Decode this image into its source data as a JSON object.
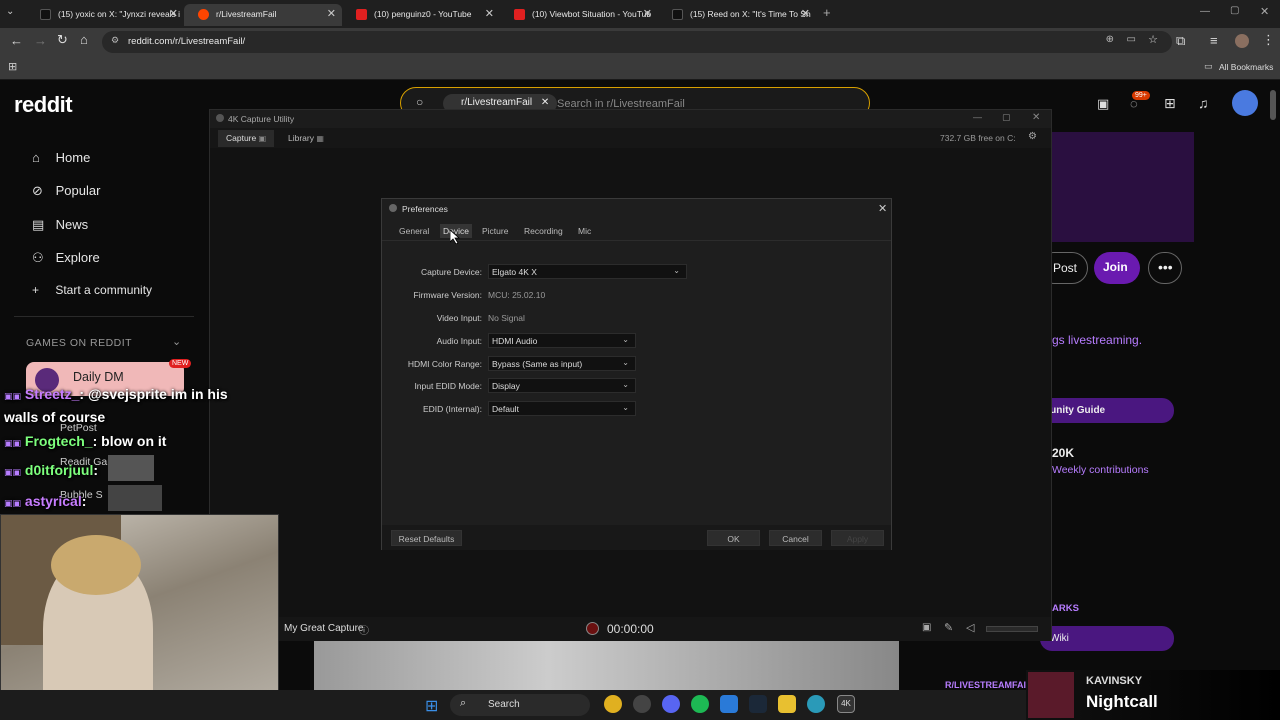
{
  "browser": {
    "tabs": [
      {
        "label": "(15) yoxic on X: \"Jynxzi reveals i",
        "fav": "#111"
      },
      {
        "label": "r/LivestreamFail",
        "fav": "#ff4500"
      },
      {
        "label": "(10) penguinz0 - YouTube",
        "fav": "#e02020"
      },
      {
        "label": "(10) Viewbot Situation - YouTub",
        "fav": "#e02020"
      },
      {
        "label": "(15) Reed on X: \"It's Time To Sh",
        "fav": "#111"
      }
    ],
    "url": "reddit.com/r/LivestreamFail/",
    "all_bookmarks": "All Bookmarks"
  },
  "reddit": {
    "logo": "reddit",
    "search_chip": "r/LivestreamFail",
    "search_placeholder": "Search in r/LivestreamFail",
    "notif_count": "99+",
    "nav": [
      {
        "label": "Home",
        "icon": "home-icon",
        "glyph": "⌂"
      },
      {
        "label": "Popular",
        "icon": "popular-icon",
        "glyph": "⊘"
      },
      {
        "label": "News",
        "icon": "news-icon",
        "glyph": "▤"
      },
      {
        "label": "Explore",
        "icon": "explore-icon",
        "glyph": "⚇"
      },
      {
        "label": "Start a community",
        "icon": "plus-icon",
        "glyph": "+"
      }
    ],
    "games_header": "GAMES ON REDDIT",
    "games": [
      {
        "name": "Daily DM",
        "badge": "NEW"
      },
      {
        "name": "PetPost"
      },
      {
        "name": "Readit Gam"
      },
      {
        "name": "Bubble S"
      }
    ],
    "right": {
      "post": "Post",
      "join": "Join",
      "desc": "gs livestreaming.",
      "guide": "nunity Guide",
      "count": "20K",
      "weekly": "Weekly contributions",
      "marks": "ARKS",
      "wiki": "Wiki",
      "sub": "R/LIVESTREAMFAIL"
    }
  },
  "capture": {
    "title": "4K Capture Utility",
    "tabs": [
      "Capture",
      "Library"
    ],
    "free_space": "732.7 GB free on C:",
    "capture_name": "My Great Capture",
    "timer": "00:00:00"
  },
  "prefs": {
    "title": "Preferences",
    "tabs": [
      "General",
      "Device",
      "Picture",
      "Recording",
      "Mic"
    ],
    "active_tab": "Device",
    "rows": [
      {
        "label": "Capture Device:",
        "value": "Elgato 4K X",
        "type": "select"
      },
      {
        "label": "Firmware Version:",
        "value": "MCU: 25.02.10",
        "type": "text"
      },
      {
        "label": "Video Input:",
        "value": "No Signal",
        "type": "text"
      },
      {
        "label": "Audio Input:",
        "value": "HDMI Audio",
        "type": "select"
      },
      {
        "label": "HDMI Color Range:",
        "value": "Bypass (Same as input)",
        "type": "select"
      },
      {
        "label": "Input EDID Mode:",
        "value": "Display",
        "type": "select"
      },
      {
        "label": "EDID (Internal):",
        "value": "Default",
        "type": "select"
      }
    ],
    "reset": "Reset Defaults",
    "ok": "OK",
    "cancel": "Cancel",
    "apply": "Apply"
  },
  "chat": [
    {
      "user": "Streetz_",
      "text": "@svejsprite im in his",
      "color": "#ff7ad9"
    },
    {
      "user": "",
      "text": "walls of course",
      "color": "#fff"
    },
    {
      "user": "Frogtech_",
      "text": "blow on it",
      "color": "#7dff7d"
    },
    {
      "user": "d0itforjuul",
      "text": "",
      "color": "#7dff7d"
    },
    {
      "user": "astyrical",
      "text": "",
      "color": "#c77dff"
    }
  ],
  "taskbar": {
    "search": "Search"
  },
  "music": {
    "artist": "KAVINSKY",
    "title": "Nightcall"
  }
}
